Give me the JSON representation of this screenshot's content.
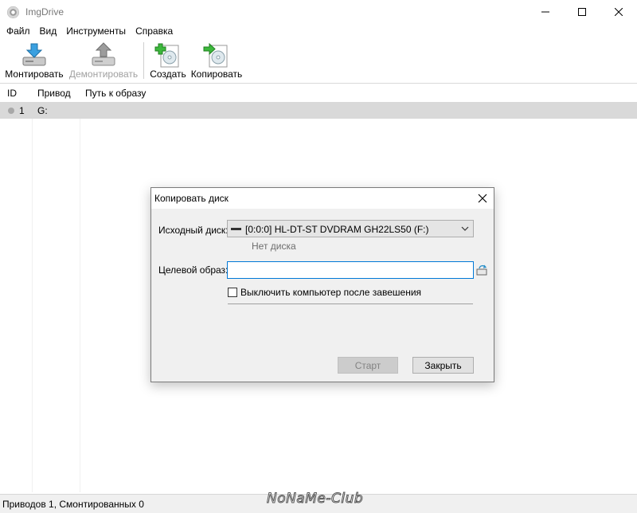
{
  "window": {
    "title": "ImgDrive"
  },
  "menu": [
    "Файл",
    "Вид",
    "Инструменты",
    "Справка"
  ],
  "toolbar": {
    "mount": "Монтировать",
    "unmount": "Демонтировать",
    "create": "Создать",
    "copy": "Копировать"
  },
  "list": {
    "columns": [
      "ID",
      "Привод",
      "Путь к образу"
    ],
    "rows": [
      {
        "id": "1",
        "drive": "G:",
        "path": ""
      }
    ]
  },
  "status": {
    "text": "Приводов 1, Смонтированных 0"
  },
  "watermark": "NoNaMe-Club",
  "dialog": {
    "title": "Копировать диск",
    "source_label": "Исходный диск:",
    "source_value": "[0:0:0] HL-DT-ST DVDRAM GH22LS50 (F:)",
    "no_disc": "Нет диска",
    "target_label": "Целевой образ:",
    "target_value": "",
    "shutdown_label": "Выключить компьютер после завешения",
    "start": "Старт",
    "close": "Закрыть"
  },
  "colors": {
    "accent": "#0078d7",
    "selection": "#d9d9d9",
    "mount_arrow": "#3aa0e0",
    "create_plus": "#3db83d"
  }
}
